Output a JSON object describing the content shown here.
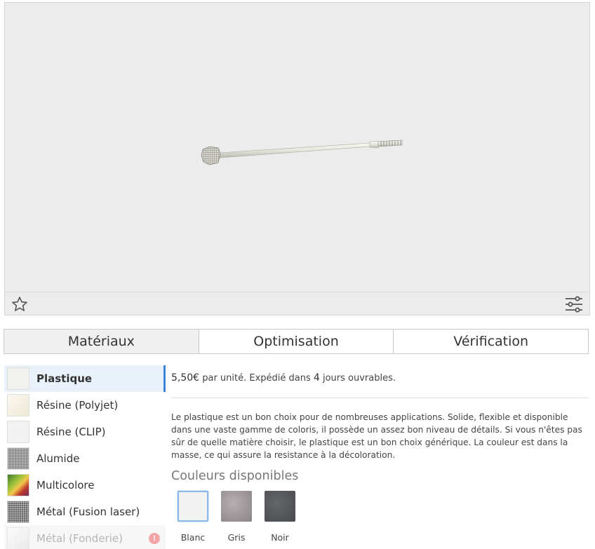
{
  "viewer": {
    "favorite_icon": "star-outline-icon",
    "settings_icon": "sliders-icon"
  },
  "tabs": [
    {
      "label": "Matériaux",
      "active": true
    },
    {
      "label": "Optimisation",
      "active": false
    },
    {
      "label": "Vérification",
      "active": false
    }
  ],
  "materials": [
    {
      "label": "Plastique",
      "selected": true
    },
    {
      "label": "Résine (Polyjet)"
    },
    {
      "label": "Résine (CLIP)"
    },
    {
      "label": "Alumide"
    },
    {
      "label": "Multicolore"
    },
    {
      "label": "Métal (Fusion laser)"
    },
    {
      "label": "Métal (Fonderie)",
      "disabled": true,
      "warning_icon": "exclamation-icon"
    }
  ],
  "pricing": {
    "price": "5,50€",
    "unit_text": "par unité. Expédié dans",
    "days": "4",
    "days_text": "jours ouvrables."
  },
  "description": "Le plastique est un bon choix pour de nombreuses applications. Solide, flexible et disponible dans une vaste gamme de coloris, il possède un assez bon niveau de détails. Si vous n'êtes pas sûr de quelle matière choisir, le plastique est un bon choix générique. La couleur est dans la masse, ce qui assure la resistance à la décoloration.",
  "colors": {
    "title": "Couleurs disponibles",
    "options": [
      {
        "name": "Blanc",
        "hex": "#f2f2f2",
        "selected": true
      },
      {
        "name": "Gris",
        "hex": "#9a9396"
      },
      {
        "name": "Noir",
        "hex": "#55575b"
      }
    ]
  },
  "accent_color": "#3a86d6"
}
